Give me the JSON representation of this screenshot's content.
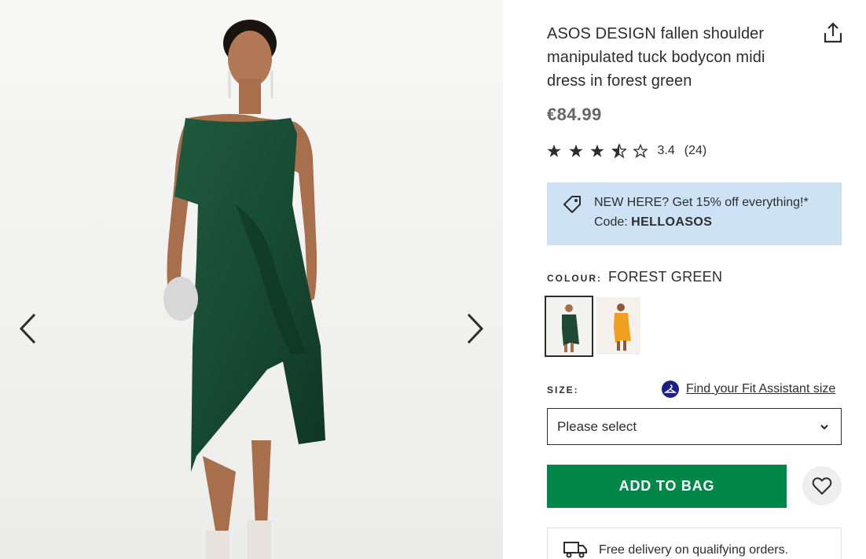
{
  "gallery": {
    "prev_icon": "chevron-left-icon",
    "next_icon": "chevron-right-icon"
  },
  "product": {
    "title": "ASOS DESIGN fallen shoulder manipulated tuck bodycon midi dress in forest green",
    "price": "€84.99",
    "rating_value": "3.4",
    "rating_count": "(24)",
    "rating_stars": 3.5
  },
  "promo": {
    "icon": "tag-icon",
    "line1": "NEW HERE? Get 15% off everything!*",
    "code_label": "Code: ",
    "code": "HELLOASOS",
    "background": "#cde2f5"
  },
  "colour": {
    "label": "COLOUR:",
    "value": "FOREST GREEN",
    "swatches": [
      {
        "name": "forest green",
        "selected": true,
        "color": "#1e4a35"
      },
      {
        "name": "orange",
        "selected": false,
        "color": "#f0a020"
      }
    ]
  },
  "size": {
    "label": "SIZE:",
    "fit_link": "Find your Fit Assistant size",
    "select_value": "Please select"
  },
  "actions": {
    "add_to_bag": "ADD TO BAG",
    "add_color": "#018849",
    "wishlist_icon": "heart-icon"
  },
  "delivery": {
    "icon": "truck-icon",
    "text": "Free delivery on qualifying orders."
  }
}
